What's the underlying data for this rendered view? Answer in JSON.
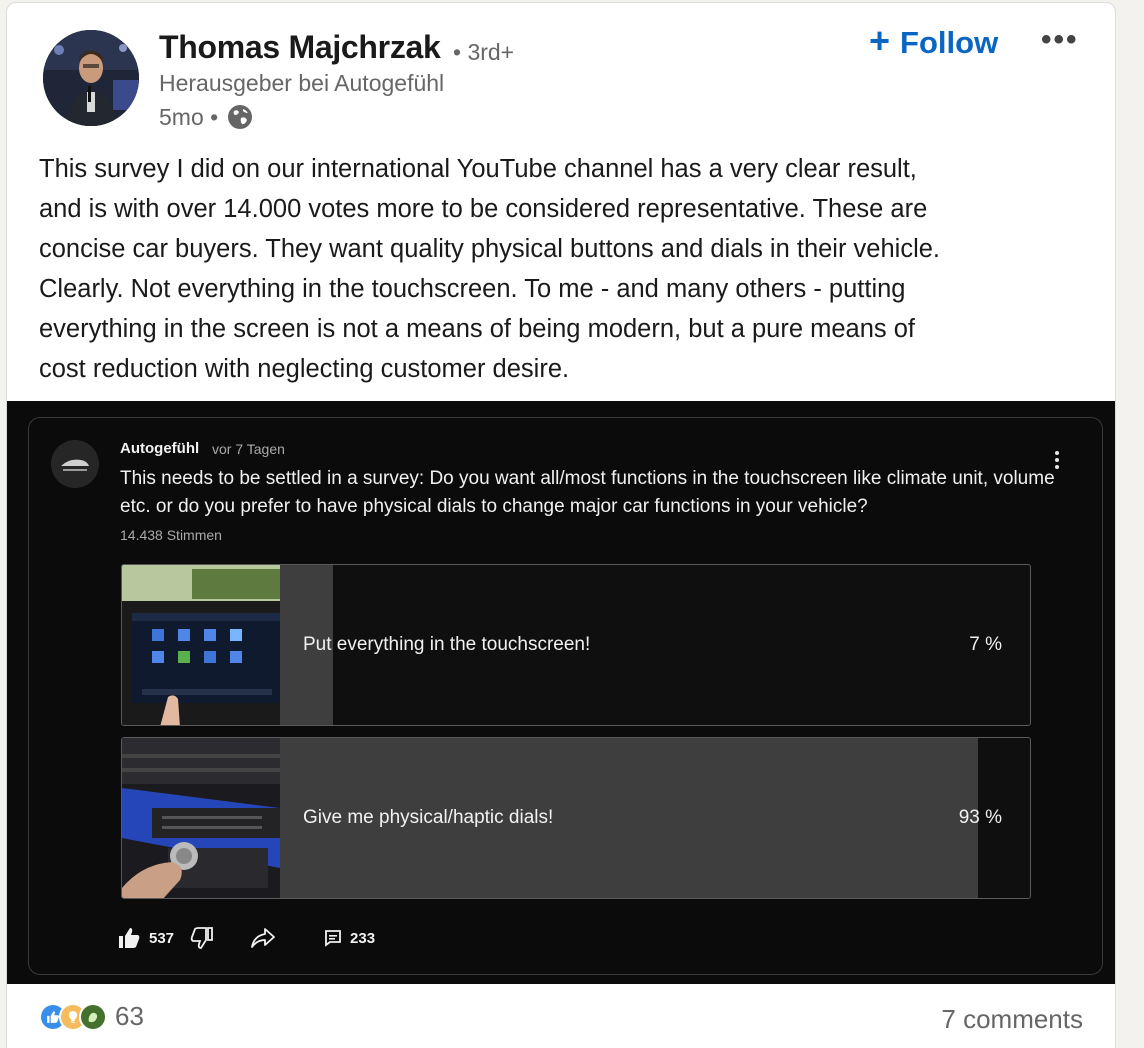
{
  "post": {
    "author": {
      "name": "Thomas Majchrzak",
      "degree": "• 3rd+",
      "headline": "Herausgeber bei Autogefühl",
      "timestamp": "5mo •"
    },
    "follow_label": "Follow",
    "more_label": "•••",
    "body_lines": [
      "This survey I did on our international YouTube channel has a very clear result,",
      "and is with over 14.000 votes more to be considered representative. These are",
      "concise car buyers. They want quality physical buttons and dials in their vehicle.",
      "Clearly. Not everything in the touchscreen. To me - and many others - putting",
      "everything in the screen is not a means of being modern, but a pure means of",
      "cost reduction with neglecting customer desire."
    ],
    "reactions_count": "63",
    "comments_label": "7 comments"
  },
  "youtube_poll": {
    "channel": "Autogefühl",
    "age": "vor 7 Tagen",
    "question": "This needs to be settled in a survey: Do you want all/most functions in the touchscreen like climate unit, volume etc. or do you prefer to have physical dials to change major car functions in your vehicle?",
    "votes": "14.438 Stimmen",
    "options": [
      {
        "label": "Put everything in the touchscreen!",
        "percent_label": "7 %",
        "share": 0.07
      },
      {
        "label": "Give me physical/haptic dials!",
        "percent_label": "93 %",
        "share": 0.93
      }
    ],
    "likes": "537",
    "comments": "233"
  },
  "colors": {
    "link_blue": "#0a66c2",
    "yt_background": "#0b0b0b",
    "poll_fill": "#3e3e3e"
  }
}
